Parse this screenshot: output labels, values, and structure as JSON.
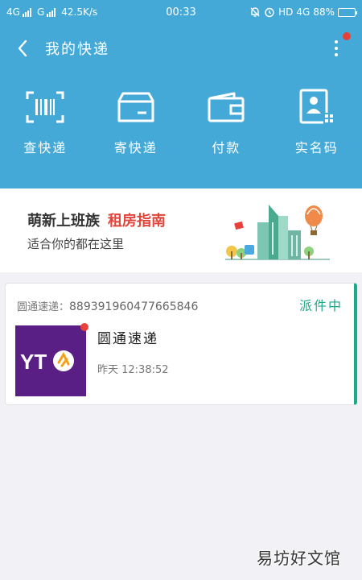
{
  "status_bar": {
    "network1": "4G",
    "network2": "G",
    "speed": "42.5K/s",
    "time": "00:33",
    "hd": "HD",
    "network3": "4G",
    "battery": "88%",
    "battery_level": 0.88
  },
  "header": {
    "title": "我的快递",
    "has_notification": true
  },
  "actions": [
    {
      "label": "查快递",
      "icon": "barcode-scan-icon"
    },
    {
      "label": "寄快递",
      "icon": "parcel-box-icon"
    },
    {
      "label": "付款",
      "icon": "wallet-icon"
    },
    {
      "label": "实名码",
      "icon": "id-card-qr-icon"
    }
  ],
  "banner": {
    "title": "萌新上班族",
    "highlight": "租房指南",
    "subtitle": "适合你的都在这里",
    "highlight_color": "#e0453c"
  },
  "parcel": {
    "carrier_prefix": "圆通速递：",
    "tracking_number": "889391960477665846",
    "status": "派件中",
    "company": "圆通速递",
    "time": "昨天 12:38:52",
    "logo_text": "YTO",
    "status_color": "#1ea988"
  },
  "watermark": "易坊好文馆",
  "colors": {
    "header_bg": "#45a9d8",
    "logo_bg": "#5a1f85"
  }
}
